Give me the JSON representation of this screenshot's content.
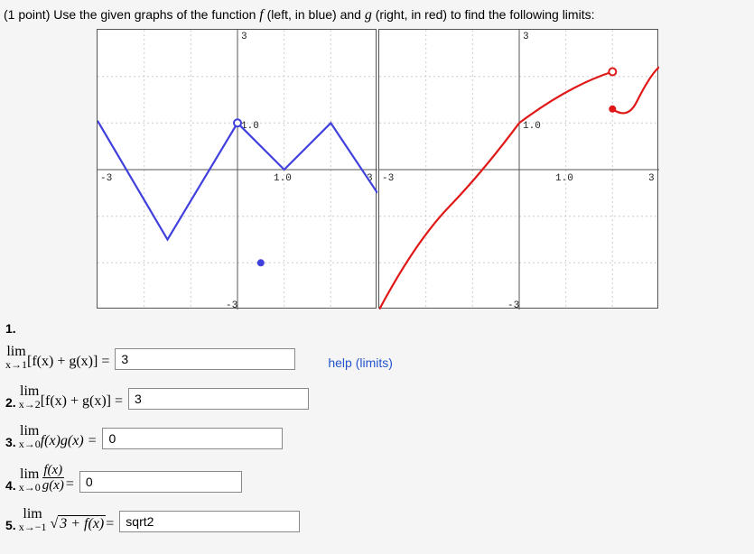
{
  "prompt": {
    "points": "(1 point)",
    "text_pre": " Use the given graphs of the function ",
    "fn_f": "f",
    "text_mid": " (left, in blue) and ",
    "fn_g": "g",
    "text_post": " (right, in red) to find the following limits:"
  },
  "chart_data": [
    {
      "type": "line",
      "title": "f",
      "xlim": [
        -3,
        3
      ],
      "ylim": [
        -3,
        3
      ],
      "xticks": [
        -3,
        "1.0"
      ],
      "yticks": [
        "1.0",
        -3
      ],
      "color": "#3333cc",
      "series": [
        {
          "points": [
            [
              -3,
              1.05
            ],
            [
              -1.5,
              -1.5
            ],
            [
              0,
              1
            ],
            [
              1,
              0
            ],
            [
              2,
              1
            ],
            [
              3,
              -0.5
            ]
          ],
          "open_circles": [
            [
              0,
              1
            ]
          ]
        }
      ],
      "isolated_points": [
        [
          0.5,
          -2
        ]
      ]
    },
    {
      "type": "line",
      "title": "g",
      "xlim": [
        -3,
        3
      ],
      "ylim": [
        -3,
        3
      ],
      "xticks": [
        -3,
        "1.0"
      ],
      "yticks": [
        "1.0",
        -3
      ],
      "color": "#dd1111",
      "series": [
        {
          "points": [
            [
              -3,
              -3
            ],
            [
              -2.5,
              -2.1
            ],
            [
              -2,
              -1.2
            ],
            [
              -1,
              0
            ],
            [
              0,
              1
            ],
            [
              1,
              1.7
            ],
            [
              2,
              2.1
            ]
          ],
          "open_circles": [
            [
              2,
              2.1
            ]
          ]
        },
        {
          "points": [
            [
              2,
              1.3
            ],
            [
              2.3,
              1.1
            ],
            [
              2.6,
              1.5
            ],
            [
              3,
              2.2
            ]
          ],
          "closed_circles": [
            [
              2,
              1.3
            ]
          ]
        }
      ]
    }
  ],
  "questions": {
    "q1": {
      "num": "1.",
      "lim": "lim",
      "sub": "x→1",
      "expr": "[f(x) + g(x)] = ",
      "value": "3"
    },
    "q2": {
      "num": "2. ",
      "lim": "lim",
      "sub": "x→2",
      "expr": "[f(x) + g(x)] = ",
      "value": "3"
    },
    "q3": {
      "num": "3. ",
      "lim": "lim",
      "sub": "x→0",
      "expr": "f(x)g(x) = ",
      "value": "0"
    },
    "q4": {
      "num": "4. ",
      "lim": "lim",
      "sub": "x→0",
      "frac_num": "f(x)",
      "frac_den": "g(x)",
      "eq": " = ",
      "value": "0"
    },
    "q5": {
      "num": "5. ",
      "lim": "lim",
      "sub": "x→−1",
      "expr_root": "3 + f(x)",
      "eq": " = ",
      "value": "sqrt2"
    }
  },
  "help_text": "help (limits)"
}
